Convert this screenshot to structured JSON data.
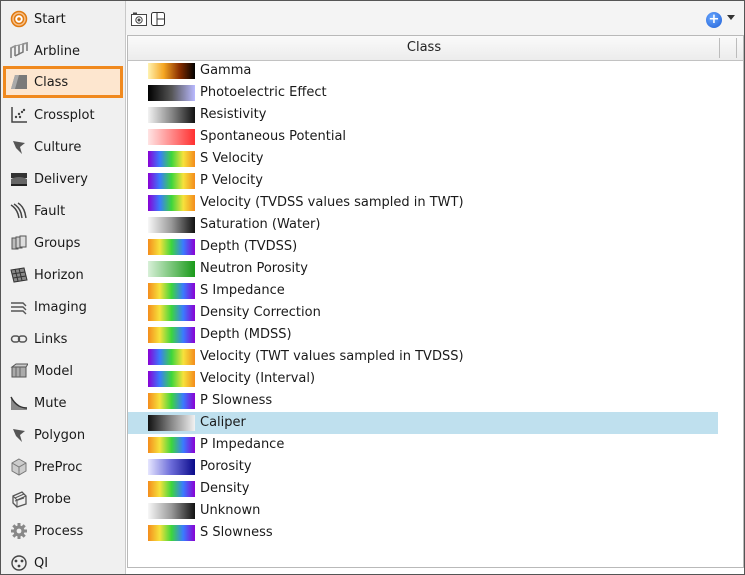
{
  "sidebar": {
    "items": [
      {
        "label": "Start",
        "icon": "target-icon",
        "selected": false
      },
      {
        "label": "Arbline",
        "icon": "arbline-icon",
        "selected": false
      },
      {
        "label": "Class",
        "icon": "class-icon",
        "selected": true
      },
      {
        "label": "Crossplot",
        "icon": "crossplot-icon",
        "selected": false
      },
      {
        "label": "Culture",
        "icon": "culture-icon",
        "selected": false
      },
      {
        "label": "Delivery",
        "icon": "delivery-icon",
        "selected": false
      },
      {
        "label": "Fault",
        "icon": "fault-icon",
        "selected": false
      },
      {
        "label": "Groups",
        "icon": "groups-icon",
        "selected": false
      },
      {
        "label": "Horizon",
        "icon": "horizon-icon",
        "selected": false
      },
      {
        "label": "Imaging",
        "icon": "imaging-icon",
        "selected": false
      },
      {
        "label": "Links",
        "icon": "links-icon",
        "selected": false
      },
      {
        "label": "Model",
        "icon": "model-icon",
        "selected": false
      },
      {
        "label": "Mute",
        "icon": "mute-icon",
        "selected": false
      },
      {
        "label": "Polygon",
        "icon": "polygon-icon",
        "selected": false
      },
      {
        "label": "PreProc",
        "icon": "preproc-icon",
        "selected": false
      },
      {
        "label": "Probe",
        "icon": "probe-icon",
        "selected": false
      },
      {
        "label": "Process",
        "icon": "gear-icon",
        "selected": false
      },
      {
        "label": "QI",
        "icon": "qi-icon",
        "selected": false
      }
    ]
  },
  "toolbar": {
    "icons": [
      "camera-icon",
      "layout-icon"
    ],
    "add_icon": "plus-circle-icon",
    "add_symbol": "+"
  },
  "list": {
    "header": "Class",
    "rows": [
      {
        "label": "Gamma",
        "gradient": "linear-gradient(90deg,#fff2b0,#f5a623,#8b2f00,#000)",
        "selected": false
      },
      {
        "label": "Photoelectric Effect",
        "gradient": "linear-gradient(90deg,#000,#555,#b9b9ff)",
        "selected": false
      },
      {
        "label": "Resistivity",
        "gradient": "linear-gradient(90deg,#f2f2f2,#888,#111)",
        "selected": false
      },
      {
        "label": "Spontaneous Potential",
        "gradient": "linear-gradient(90deg,#ffe4e4,#ff3030)",
        "selected": false
      },
      {
        "label": "S Velocity",
        "gradient": "linear-gradient(90deg,#8a00d4,#3a7bff,#3cd63c,#f6e23c,#f48c1c)",
        "selected": false
      },
      {
        "label": "P Velocity",
        "gradient": "linear-gradient(90deg,#8a00d4,#3a7bff,#3cd63c,#f6e23c,#f48c1c)",
        "selected": false
      },
      {
        "label": "Velocity (TVDSS values sampled in TWT)",
        "gradient": "linear-gradient(90deg,#8a00d4,#3a7bff,#3cd63c,#f6e23c,#f48c1c)",
        "selected": false
      },
      {
        "label": "Saturation (Water)",
        "gradient": "linear-gradient(90deg,#f7f7f7,#999,#111)",
        "selected": false
      },
      {
        "label": "Depth (TVDSS)",
        "gradient": "linear-gradient(90deg,#f48c1c,#f6e23c,#3cd63c,#3a7bff,#8a00d4)",
        "selected": false
      },
      {
        "label": "Neutron Porosity",
        "gradient": "linear-gradient(90deg,#d8f0d8,#1a9a1a)",
        "selected": false
      },
      {
        "label": "S Impedance",
        "gradient": "linear-gradient(90deg,#f48c1c,#f6e23c,#3cd63c,#3a7bff,#8a00d4)",
        "selected": false
      },
      {
        "label": "Density Correction",
        "gradient": "linear-gradient(90deg,#f48c1c,#f6e23c,#3cd63c,#3a7bff,#8a00d4)",
        "selected": false
      },
      {
        "label": "Depth (MDSS)",
        "gradient": "linear-gradient(90deg,#f48c1c,#f6e23c,#3cd63c,#3a7bff,#8a00d4)",
        "selected": false
      },
      {
        "label": "Velocity (TWT values sampled in TVDSS)",
        "gradient": "linear-gradient(90deg,#8a00d4,#3a7bff,#3cd63c,#f6e23c,#f48c1c)",
        "selected": false
      },
      {
        "label": "Velocity (Interval)",
        "gradient": "linear-gradient(90deg,#8a00d4,#3a7bff,#3cd63c,#f6e23c,#f48c1c)",
        "selected": false
      },
      {
        "label": "P Slowness",
        "gradient": "linear-gradient(90deg,#f48c1c,#f6e23c,#3cd63c,#3a7bff,#8a00d4)",
        "selected": false
      },
      {
        "label": "Caliper",
        "gradient": "linear-gradient(90deg,#111,#888,#f2f2f2)",
        "selected": true
      },
      {
        "label": "P Impedance",
        "gradient": "linear-gradient(90deg,#f48c1c,#f6e23c,#3cd63c,#3a7bff,#8a00d4)",
        "selected": false
      },
      {
        "label": "Porosity",
        "gradient": "linear-gradient(90deg,#e6e6ff,#6a6ad8,#0a0a8a)",
        "selected": false
      },
      {
        "label": "Density",
        "gradient": "linear-gradient(90deg,#f48c1c,#f6e23c,#3cd63c,#3a7bff,#8a00d4)",
        "selected": false
      },
      {
        "label": "Unknown",
        "gradient": "linear-gradient(90deg,#f7f7f7,#999,#111)",
        "selected": false
      },
      {
        "label": "S Slowness",
        "gradient": "linear-gradient(90deg,#f48c1c,#f6e23c,#3cd63c,#3a7bff,#8a00d4)",
        "selected": false
      }
    ]
  },
  "colors": {
    "accent_orange": "#f0891e",
    "selected_tab_bg": "#fde6cf",
    "selected_row_bg": "#bfe0ee",
    "sidebar_bg": "#f0f0f0"
  }
}
